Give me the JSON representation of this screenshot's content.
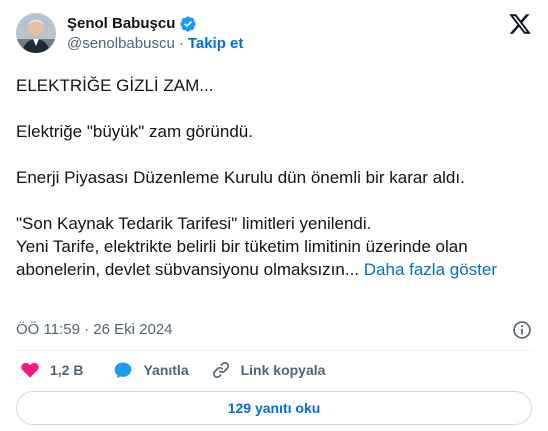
{
  "author": {
    "name": "Şenol Babuşcu",
    "handle": "@senolbabuscu",
    "separator": "·",
    "follow_label": "Takip et",
    "verified": true,
    "verified_color": "#1d9bf0"
  },
  "tweet": {
    "paragraphs": [
      "ELEKTRİĞE GİZLİ ZAM...",
      "Elektriğe \"büyük\" zam göründü.",
      "Enerji Piyasası Düzenleme Kurulu dün önemli bir karar aldı.",
      "\"Son Kaynak Tedarik Tarifesi\" limitleri yenilendi.\nYeni Tarife, elektrikte belirli bir tüketim limitinin üzerinde olan abonelerin, devlet sübvansiyonu olmaksızın..."
    ],
    "show_more_label": "Daha fazla göster",
    "timestamp": "ÖÖ 11:59 · 26 Eki 2024"
  },
  "actions": {
    "like_count": "1,2 B",
    "reply_label": "Yanıtla",
    "copy_link_label": "Link kopyala"
  },
  "replies_button_label": "129 yanıtı oku",
  "icons": {
    "logo": "x-logo-icon",
    "verified": "verified-badge-icon",
    "info": "info-icon",
    "like": "heart-icon",
    "reply": "speech-bubble-icon",
    "copy": "link-icon"
  },
  "colors": {
    "accent": "#006fd6",
    "like": "#f91880",
    "reply": "#1d9bf0",
    "muted": "#536471",
    "text": "#0f1419"
  }
}
